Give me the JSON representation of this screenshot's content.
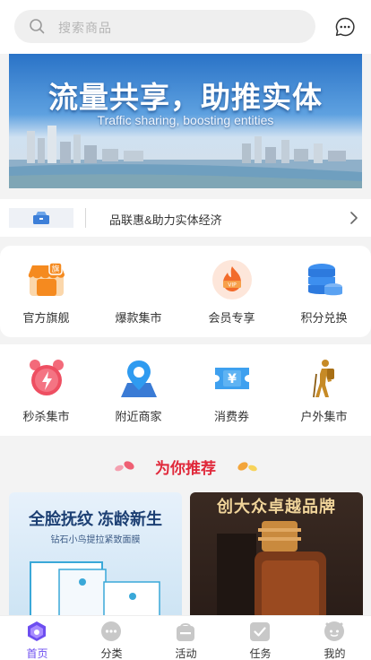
{
  "search": {
    "placeholder": "搜索商品",
    "icon": "search-icon"
  },
  "header": {
    "message_icon": "chat-bubble-icon"
  },
  "banner": {
    "title": "流量共享，助推实体",
    "subtitle": "Traffic sharing, boosting entities"
  },
  "notice": {
    "text": "品联惠&助力实体经济",
    "icon": "chevron-right-icon"
  },
  "categories_row1": [
    {
      "label": "官方旗舰",
      "icon": "flagship-store-icon",
      "color": "#f58a1f"
    },
    {
      "label": "爆款集市",
      "icon": "",
      "color": ""
    },
    {
      "label": "会员专享",
      "icon": "vip-flame-icon",
      "color": "#f26b2b"
    },
    {
      "label": "积分兑换",
      "icon": "coins-stack-icon",
      "color": "#3d8fef"
    }
  ],
  "categories_row2": [
    {
      "label": "秒杀集市",
      "icon": "alarm-clock-icon",
      "color": "#ee4f62"
    },
    {
      "label": "附近商家",
      "icon": "map-pin-icon",
      "color": "#2f8fe8"
    },
    {
      "label": "消费券",
      "icon": "coupon-ticket-icon",
      "color": "#3ea0ef"
    },
    {
      "label": "户外集市",
      "icon": "hiker-icon",
      "color": "#c68a26"
    }
  ],
  "recommend": {
    "title": "为你推荐"
  },
  "products": [
    {
      "headline": "全脸抚纹 冻龄新生",
      "subline": "钻石小鸟提拉紧致面膜"
    },
    {
      "headline": "创大众卓越品牌"
    }
  ],
  "tabbar": [
    {
      "label": "首页",
      "icon": "home-icon",
      "active": true
    },
    {
      "label": "分类",
      "icon": "category-dots-icon",
      "active": false
    },
    {
      "label": "活动",
      "icon": "activity-bag-icon",
      "active": false
    },
    {
      "label": "任务",
      "icon": "task-check-icon",
      "active": false
    },
    {
      "label": "我的",
      "icon": "profile-icon",
      "active": false
    }
  ],
  "colors": {
    "accent": "#6d4ef0",
    "recommend_title": "#e0283a",
    "tab_inactive": "#c8c8c8"
  }
}
